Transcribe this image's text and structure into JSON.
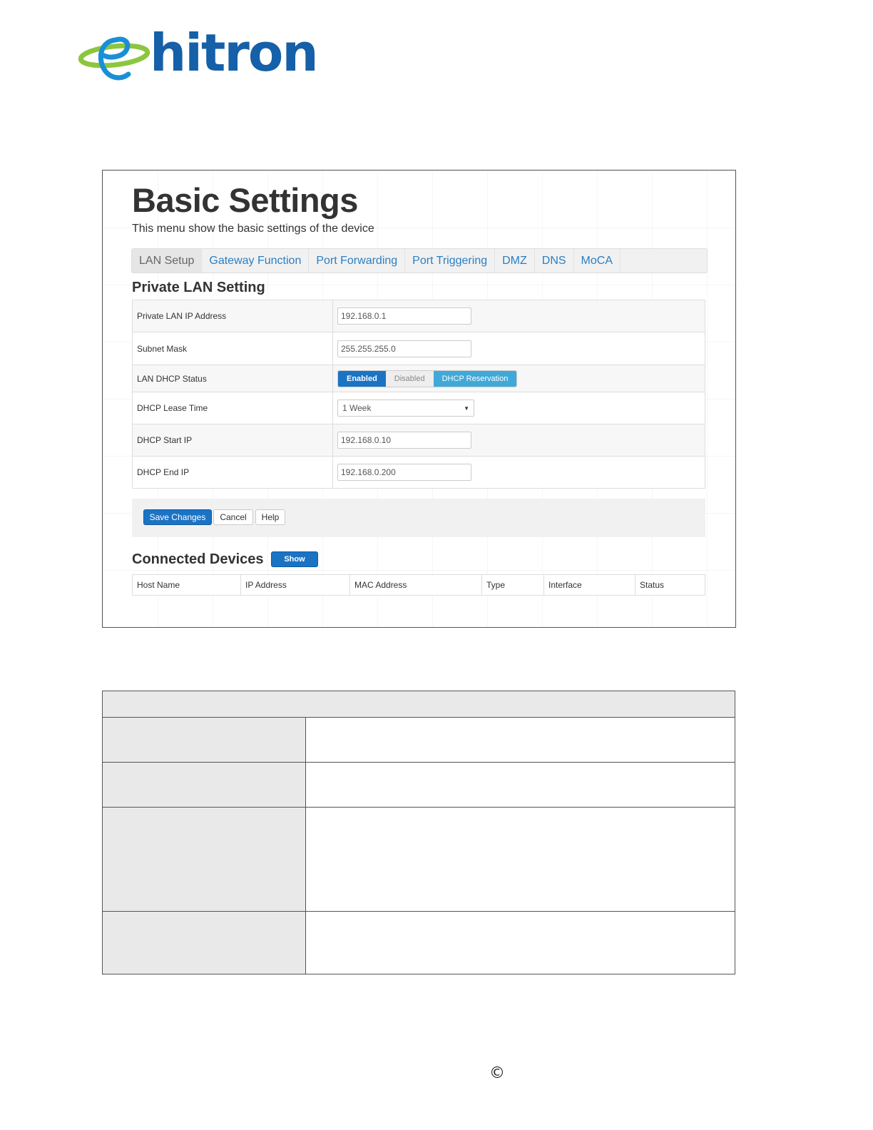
{
  "logo": {
    "text": "hitron",
    "icon": "hitron-orbit-e-icon",
    "brand_blue": "#1560a8",
    "brand_green": "#8cc63f"
  },
  "screen": {
    "title": "Basic Settings",
    "subtitle": "This menu show the basic settings of the device",
    "tabs": [
      {
        "label": "LAN Setup",
        "active": true
      },
      {
        "label": "Gateway Function"
      },
      {
        "label": "Port Forwarding"
      },
      {
        "label": "Port Triggering"
      },
      {
        "label": "DMZ"
      },
      {
        "label": "DNS"
      },
      {
        "label": "MoCA"
      }
    ],
    "private_lan": {
      "heading": "Private LAN Setting",
      "ip_label": "Private LAN IP Address",
      "ip_value": "192.168.0.1",
      "mask_label": "Subnet Mask",
      "mask_value": "255.255.255.0",
      "dhcp_status_label": "LAN DHCP Status",
      "dhcp_status_options": [
        "Enabled",
        "Disabled",
        "DHCP Reservation"
      ],
      "dhcp_status_selected": "Enabled",
      "lease_label": "DHCP Lease Time",
      "lease_value": "1 Week",
      "start_label": "DHCP Start IP",
      "start_value": "192.168.0.10",
      "end_label": "DHCP End IP",
      "end_value": "192.168.0.200"
    },
    "actions": {
      "save": "Save Changes",
      "cancel": "Cancel",
      "help": "Help"
    },
    "connected": {
      "heading": "Connected Devices",
      "show_button": "Show",
      "columns": [
        "Host Name",
        "IP Address",
        "MAC Address",
        "Type",
        "Interface",
        "Status"
      ]
    },
    "colors": {
      "primary_button": "#1b73c4",
      "reservation_button": "#40a9d8",
      "tab_link": "#2a7fc4"
    }
  },
  "footer": {
    "copyright_symbol": "©"
  }
}
